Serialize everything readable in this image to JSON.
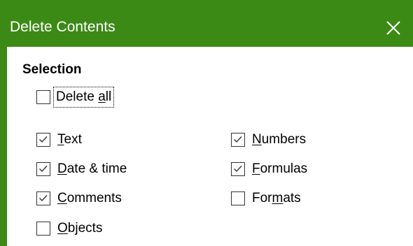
{
  "window": {
    "title": "Delete Contents",
    "close_glyph": "✕",
    "accent_color": "#3c8a16"
  },
  "selection": {
    "heading": "Selection",
    "delete_all": {
      "label_pre": "Delete ",
      "label_mn": "a",
      "label_post": "ll",
      "checked": false
    },
    "text": {
      "label_pre": "",
      "label_mn": "T",
      "label_post": "ext",
      "checked": true
    },
    "date_time": {
      "label_pre": "",
      "label_mn": "D",
      "label_post": "ate & time",
      "checked": true
    },
    "comments": {
      "label_pre": "",
      "label_mn": "C",
      "label_post": "omments",
      "checked": true
    },
    "objects": {
      "label_pre": "",
      "label_mn": "O",
      "label_post": "bjects",
      "checked": false
    },
    "numbers": {
      "label_pre": "",
      "label_mn": "N",
      "label_post": "umbers",
      "checked": true
    },
    "formulas": {
      "label_pre": "",
      "label_mn": "F",
      "label_post": "ormulas",
      "checked": true
    },
    "formats": {
      "label_pre": "For",
      "label_mn": "m",
      "label_post": "ats",
      "checked": false
    }
  }
}
